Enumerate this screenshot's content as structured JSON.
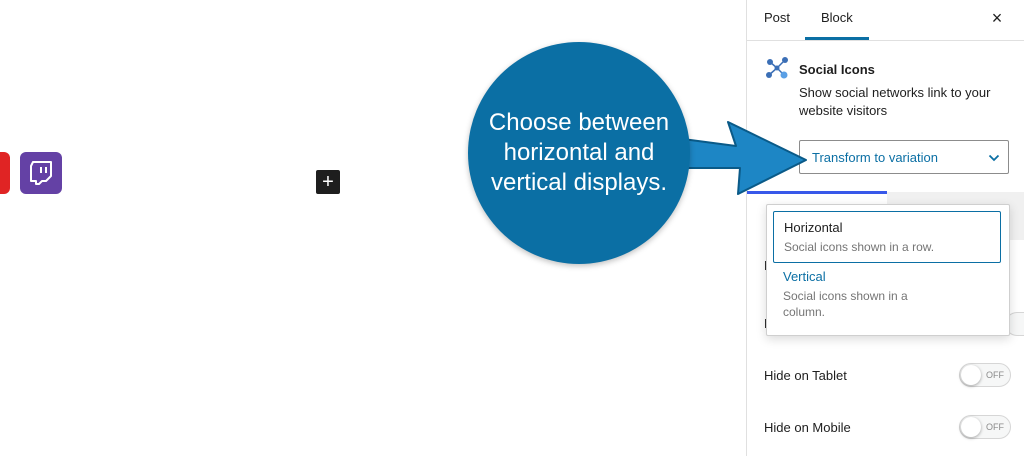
{
  "canvas": {
    "add_block_label": "+",
    "colors": {
      "red_icon": "#e02424",
      "twitch_icon": "#6441a5"
    }
  },
  "callout": {
    "text": "Choose between horizontal and vertical displays.",
    "color": "#0b6fa4"
  },
  "sidebar": {
    "tabs": [
      {
        "label": "Post"
      },
      {
        "label": "Block"
      }
    ],
    "close_label": "×",
    "block": {
      "title": "Social Icons",
      "description": "Show social networks link to your website visitors",
      "transform_label": "Transform to variation"
    },
    "partial_letters": [
      "D",
      "H"
    ],
    "hide_tablet": {
      "label": "Hide on Tablet",
      "state": "OFF"
    },
    "hide_mobile": {
      "label": "Hide on Mobile",
      "state": "OFF"
    }
  },
  "dropdown": {
    "options": [
      {
        "title": "Horizontal",
        "description": "Social icons shown in a row."
      },
      {
        "title": "Vertical",
        "description": "Social icons shown in a column."
      }
    ]
  }
}
